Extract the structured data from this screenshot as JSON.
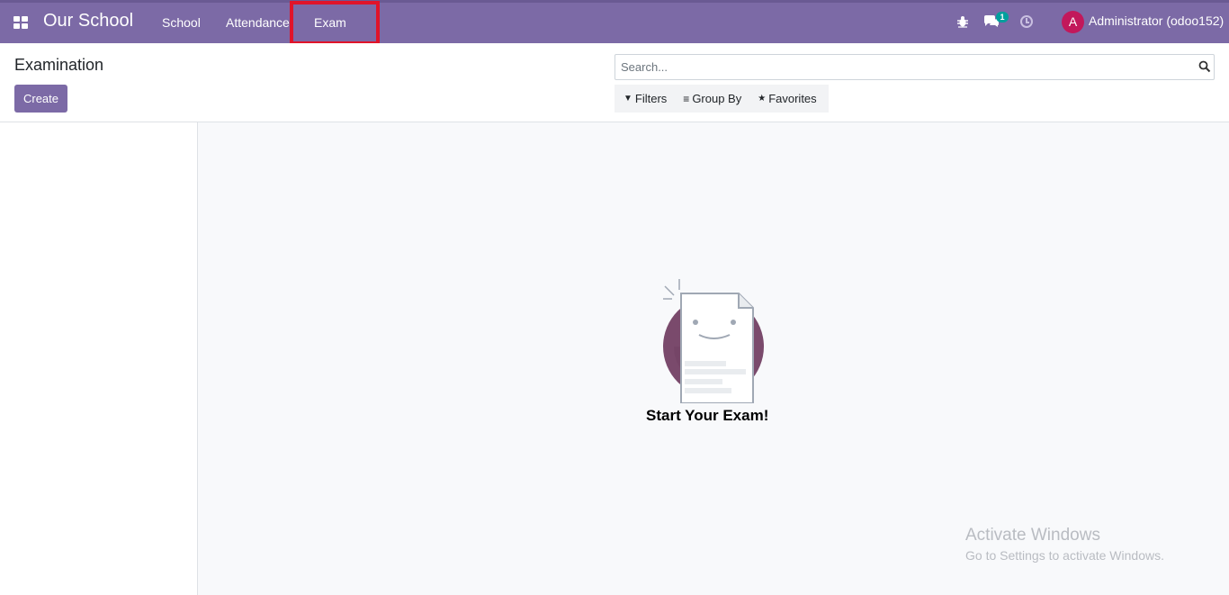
{
  "navbar": {
    "brand": "Our School",
    "menu": [
      {
        "label": "School"
      },
      {
        "label": "Attendance"
      },
      {
        "label": "Exam"
      }
    ],
    "chat_count": "1",
    "user_initial": "A",
    "user_name": "Administrator (odoo152)",
    "color": "#7c6aa6"
  },
  "control_panel": {
    "breadcrumb": "Examination",
    "create_label": "Create",
    "search_placeholder": "Search...",
    "filters_label": "Filters",
    "group_by_label": "Group By",
    "favorites_label": "Favorites"
  },
  "empty_state": {
    "title": "Start Your Exam!"
  },
  "watermark": {
    "title": "Activate Windows",
    "subtitle": "Go to Settings to activate Windows."
  }
}
